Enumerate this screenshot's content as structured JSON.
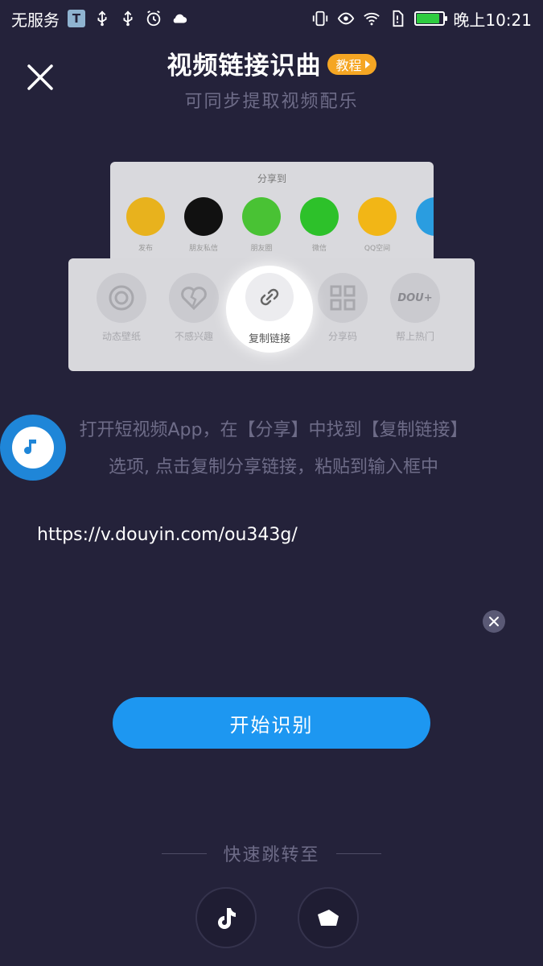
{
  "status_bar": {
    "carrier": "无服务",
    "t_badge": "T",
    "time": "晚上10:21",
    "battery_level": 0.85,
    "icons": [
      "t-icon",
      "usb-icon",
      "usb-icon",
      "alarm-icon",
      "cloud-icon",
      "vibrate-icon",
      "eye-icon",
      "wifi-icon",
      "sim-alert-icon",
      "battery-icon"
    ]
  },
  "header": {
    "title": "视频链接识曲",
    "tutorial_badge": "教程",
    "subtitle": "可同步提取视频配乐"
  },
  "illustration": {
    "share_title": "分享到",
    "share_apps": [
      {
        "label": "发布",
        "color": "#e8b21d"
      },
      {
        "label": "朋友私信",
        "color": "#111111"
      },
      {
        "label": "朋友圈",
        "color": "#49c234"
      },
      {
        "label": "微信",
        "color": "#2dc12a"
      },
      {
        "label": "QQ空间",
        "color": "#f2b616"
      },
      {
        "label": "",
        "color": "#2a9de0"
      }
    ],
    "actions": [
      {
        "label": "动态壁纸"
      },
      {
        "label": "不感兴趣"
      },
      {
        "label": "复制链接"
      },
      {
        "label": "分享码"
      },
      {
        "label": "帮上热门"
      }
    ],
    "dou_text": "DOU+"
  },
  "instructions": {
    "line1": "打开短视频App，在【分享】中找到【复制链接】",
    "line2": "选项, 点击复制分享链接，粘贴到输入框中"
  },
  "input": {
    "value": "https://v.douyin.com/ou343g/"
  },
  "primary_button": "开始识别",
  "quick_jump": {
    "label": "快速跳转至"
  },
  "colors": {
    "background": "#24223a",
    "accent": "#1d97f1",
    "badge": "#f5a623"
  }
}
